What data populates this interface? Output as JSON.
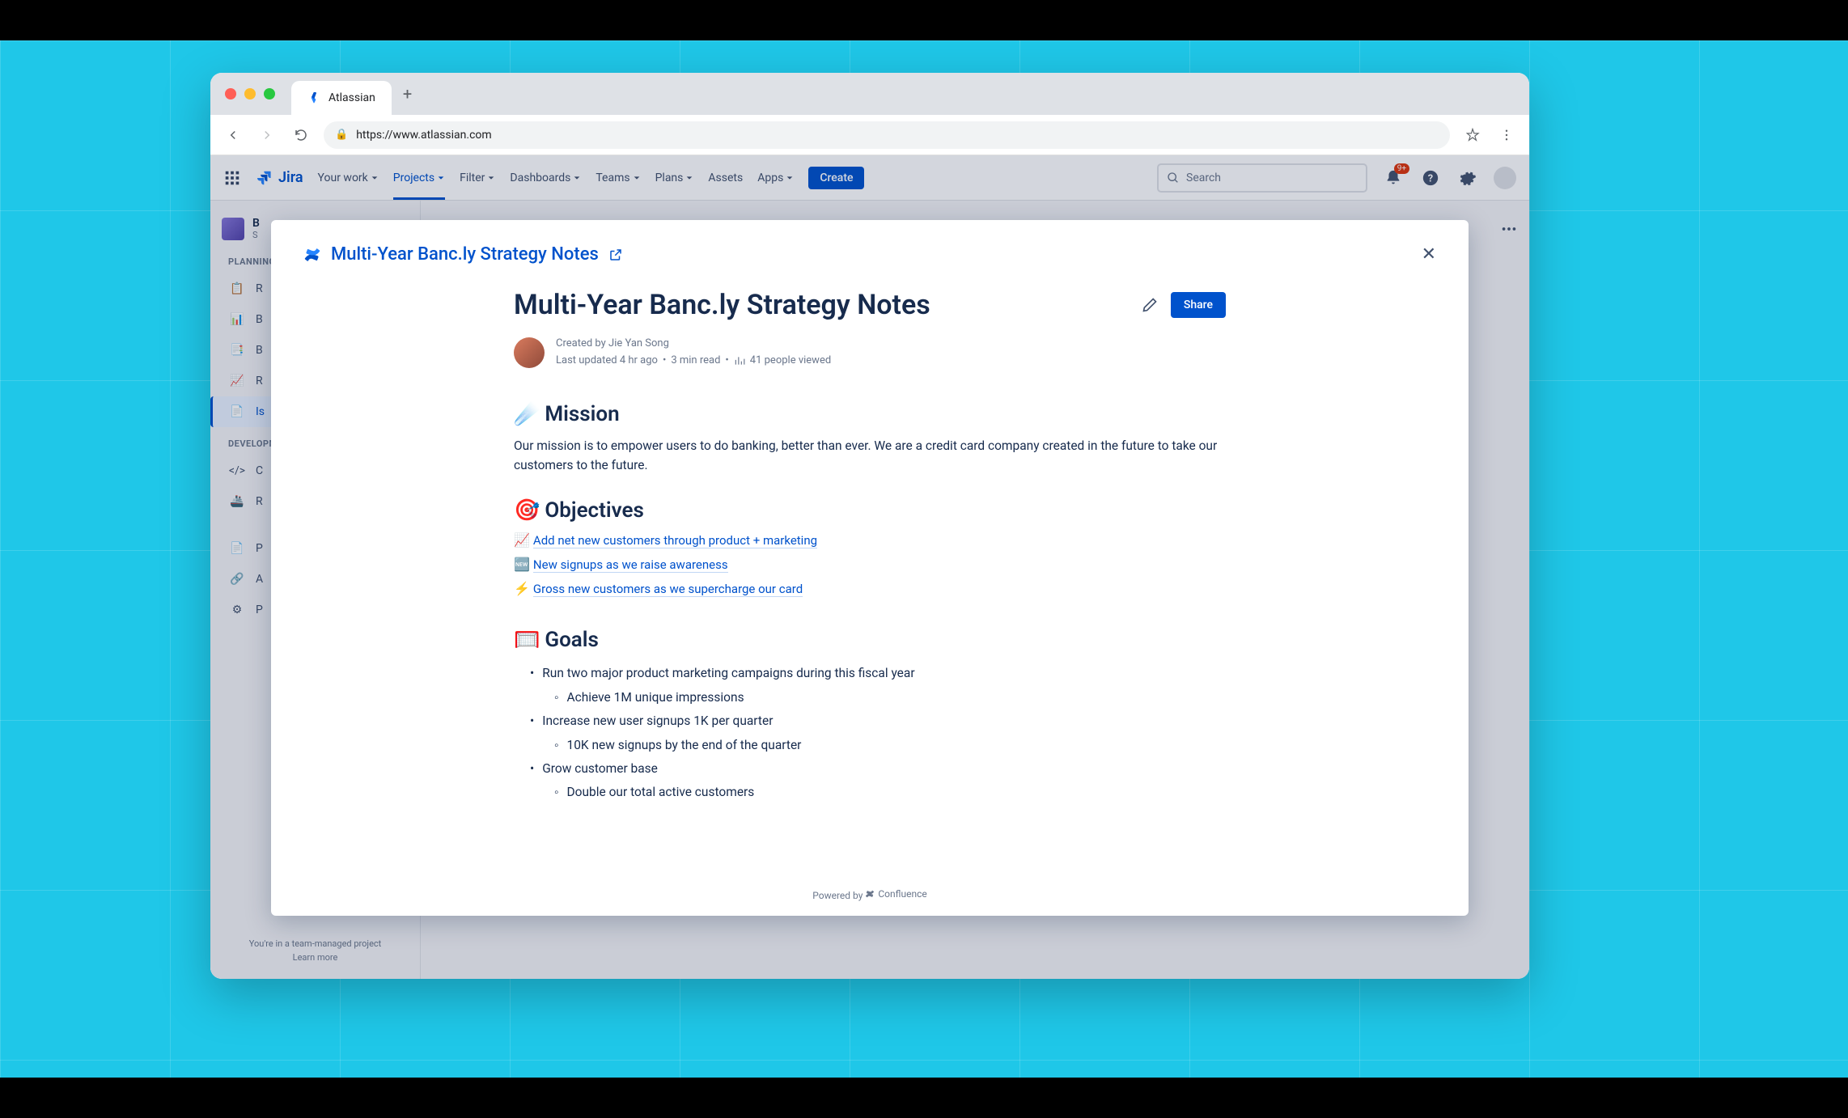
{
  "browser": {
    "tab_title": "Atlassian",
    "url": "https://www.atlassian.com"
  },
  "jira_nav": {
    "product": "Jira",
    "items": [
      "Your work",
      "Projects",
      "Filter",
      "Dashboards",
      "Teams",
      "Plans",
      "Assets",
      "Apps"
    ],
    "create": "Create",
    "search_placeholder": "Search",
    "notif_count": "9+"
  },
  "sidebar": {
    "project_initial": "B",
    "project_sub": "S",
    "sections": {
      "planning": "PLANNING",
      "development": "DEVELOPMENT"
    },
    "items_planning": [
      "R",
      "B",
      "B",
      "R",
      "Is"
    ],
    "items_dev": [
      "C",
      "R"
    ],
    "items_other": [
      "P",
      "A",
      "P"
    ],
    "footer_line1": "You're in a team-managed project",
    "footer_link": "Learn more"
  },
  "modal": {
    "breadcrumb_title": "Multi-Year Banc.ly Strategy Notes",
    "doc_title": "Multi-Year Banc.ly Strategy Notes",
    "share": "Share",
    "author_line": "Created by Jie Yan Song",
    "updated": "Last updated 4 hr ago",
    "read_time": "3 min read",
    "views": "41 people viewed",
    "mission": {
      "heading": "Mission",
      "emoji": "☄️",
      "body": "Our mission is to empower users to do banking, better than ever. We are a credit card company created in the future to take our customers to the future."
    },
    "objectives": {
      "heading": "Objectives",
      "emoji": "🎯",
      "items": [
        {
          "emoji": "📈",
          "text": "Add net new customers through product + marketing"
        },
        {
          "emoji": "🆕",
          "text": "New signups as we raise awareness"
        },
        {
          "emoji": "⚡",
          "text": "Gross new customers as we supercharge our card"
        }
      ]
    },
    "goals": {
      "heading": "Goals",
      "emoji": "🥅",
      "items": [
        {
          "text": "Run two major product marketing campaigns during this fiscal year",
          "sub": "Achieve 1M unique impressions"
        },
        {
          "text": "Increase new user signups 1K per quarter",
          "sub": "10K new signups by the end of the quarter"
        },
        {
          "text": "Grow customer base",
          "sub": "Double our total active customers"
        }
      ]
    },
    "powered_by": "Powered by",
    "powered_product": "Confluence"
  }
}
